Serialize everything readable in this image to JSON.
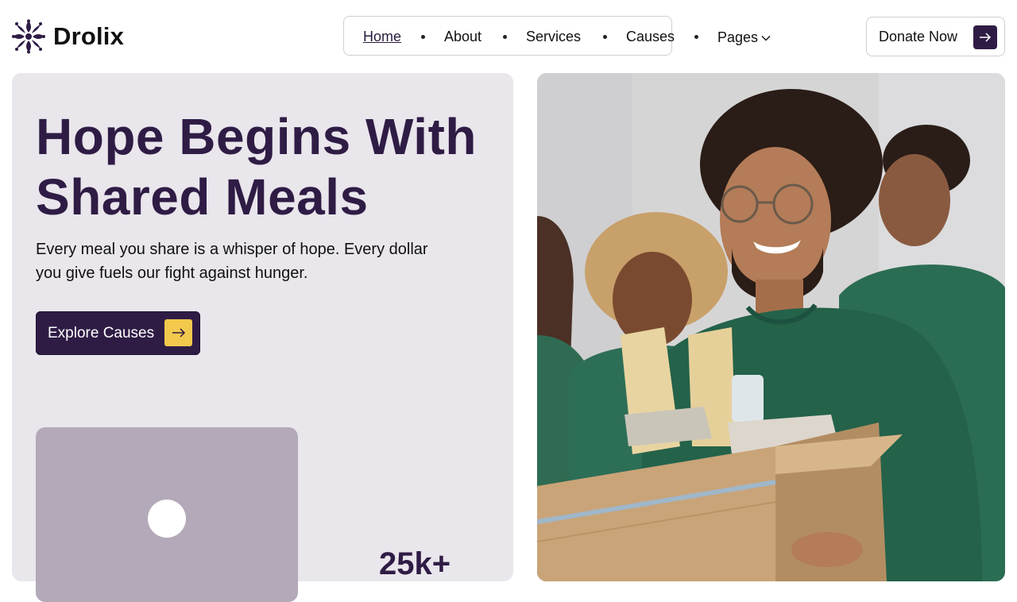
{
  "brand": {
    "name": "Drolix"
  },
  "nav": {
    "items": [
      {
        "label": "Home",
        "active": true
      },
      {
        "label": "About"
      },
      {
        "label": "Services"
      },
      {
        "label": "Causes"
      },
      {
        "label": "Pages",
        "has_dropdown": true
      }
    ]
  },
  "header": {
    "donate_label": "Donate Now"
  },
  "hero": {
    "title_line1": "Hope Begins With",
    "title_line2": "Shared Meals",
    "subtitle": "Every meal you share is a whisper of hope. Every dollar you give fuels our fight against hunger.",
    "cta_label": "Explore Causes",
    "stat_value": "25k+"
  },
  "colors": {
    "brand_primary": "#2f1c45",
    "accent_yellow": "#f2c94c",
    "panel_bg": "#e9e6ec",
    "video_card_bg": "#b3a9b8"
  },
  "icons": {
    "logo": "flower-logo-icon",
    "arrow": "arrow-right-icon",
    "dropdown": "chevron-down-icon",
    "play": "play-icon"
  }
}
